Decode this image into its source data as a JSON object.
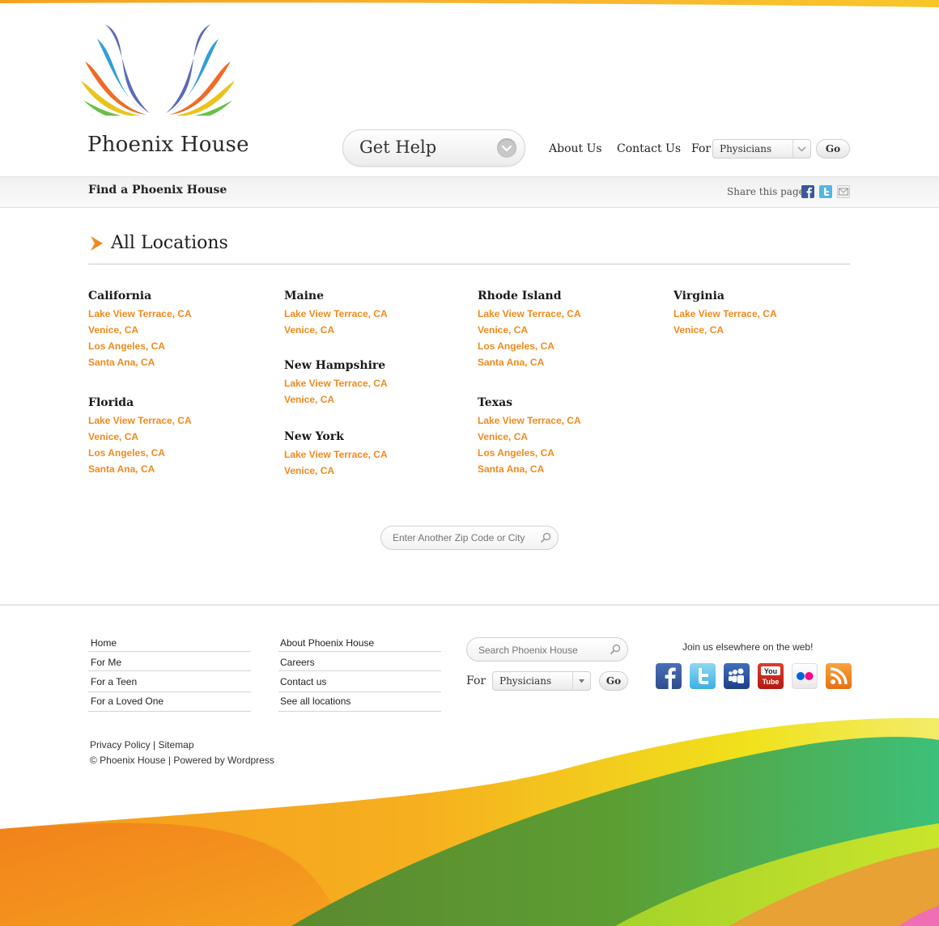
{
  "header": {
    "brand": "Phoenix House",
    "get_help": "Get Help",
    "nav": [
      "About Us",
      "Contact Us"
    ],
    "for_label": "For",
    "for_value": "Physicians",
    "go": "Go"
  },
  "subbar": {
    "title": "Find a Phoenix House",
    "share_label": "Share this page:",
    "share_icons": [
      "facebook-icon",
      "twitter-icon",
      "email-icon"
    ]
  },
  "main": {
    "heading": "All Locations",
    "columns": [
      [
        {
          "state": "California",
          "locations": [
            "Lake View Terrace, CA",
            "Venice, CA",
            "Los Angeles, CA",
            "Santa Ana, CA"
          ]
        },
        {
          "state": "Florida",
          "locations": [
            "Lake View Terrace, CA",
            "Venice, CA",
            "Los Angeles, CA",
            "Santa Ana, CA"
          ]
        }
      ],
      [
        {
          "state": "Maine",
          "locations": [
            "Lake View Terrace, CA",
            "Venice, CA"
          ]
        },
        {
          "state": "New Hampshire",
          "locations": [
            "Lake View Terrace, CA",
            "Venice, CA"
          ]
        },
        {
          "state": "New York",
          "locations": [
            "Lake View Terrace, CA",
            "Venice, CA"
          ]
        }
      ],
      [
        {
          "state": "Rhode Island",
          "locations": [
            "Lake View Terrace, CA",
            "Venice, CA",
            "Los Angeles, CA",
            "Santa Ana, CA"
          ]
        },
        {
          "state": "Texas",
          "locations": [
            "Lake View Terrace, CA",
            "Venice, CA",
            "Los Angeles, CA",
            "Santa Ana, CA"
          ]
        }
      ],
      [
        {
          "state": "Virginia",
          "locations": [
            "Lake View Terrace, CA",
            "Venice, CA"
          ]
        }
      ]
    ],
    "zip_placeholder": "Enter Another Zip Code or City"
  },
  "footer": {
    "col1": [
      "Home",
      "For Me",
      "For a Teen",
      "For a Loved One"
    ],
    "col2": [
      "About Phoenix House",
      "Careers",
      "Contact us",
      "See all locations"
    ],
    "search_placeholder": "Search Phoenix House",
    "for_label": "For",
    "for_value": "Physicians",
    "go": "Go",
    "join": "Join us elsewhere on the web!",
    "social": [
      "facebook-icon",
      "twitter-icon",
      "myspace-icon",
      "youtube-icon",
      "flickr-icon",
      "rss-icon"
    ],
    "privacy": "Privacy Policy",
    "sitemap": "Sitemap",
    "copyright": "© Phoenix House | Powered by Wordpress"
  },
  "colors": {
    "accent": "#f08a1e",
    "text": "#222222"
  }
}
